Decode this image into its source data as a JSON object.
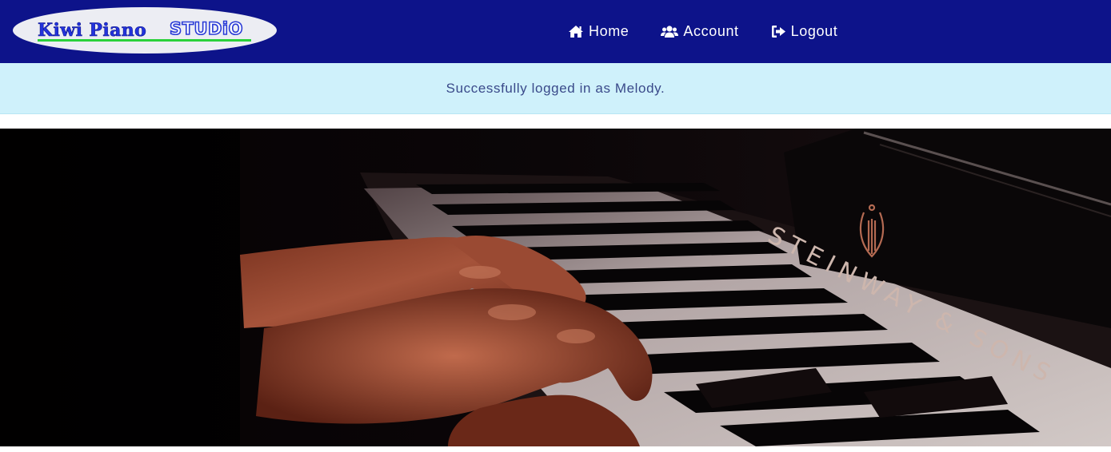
{
  "header": {
    "logo_text": "Kiwi Piano STUDiO",
    "logo_colors": {
      "oval": "#ecedf3",
      "word_primary": "#2233dd",
      "word_studio": "#2a3bd6",
      "underline": "#2ad13a"
    },
    "background": "#0d138a"
  },
  "nav": {
    "items": [
      {
        "label": "Home",
        "icon": "home-icon"
      },
      {
        "label": "Account",
        "icon": "users-icon"
      },
      {
        "label": "Logout",
        "icon": "sign-out-icon"
      }
    ]
  },
  "alert": {
    "message": "Successfully logged in as Melody.",
    "background": "#cff1fb",
    "text_color": "#3a4a8a"
  },
  "hero": {
    "image": "hands-playing-piano-photo",
    "engraving": "STEINWAY & SONS"
  }
}
